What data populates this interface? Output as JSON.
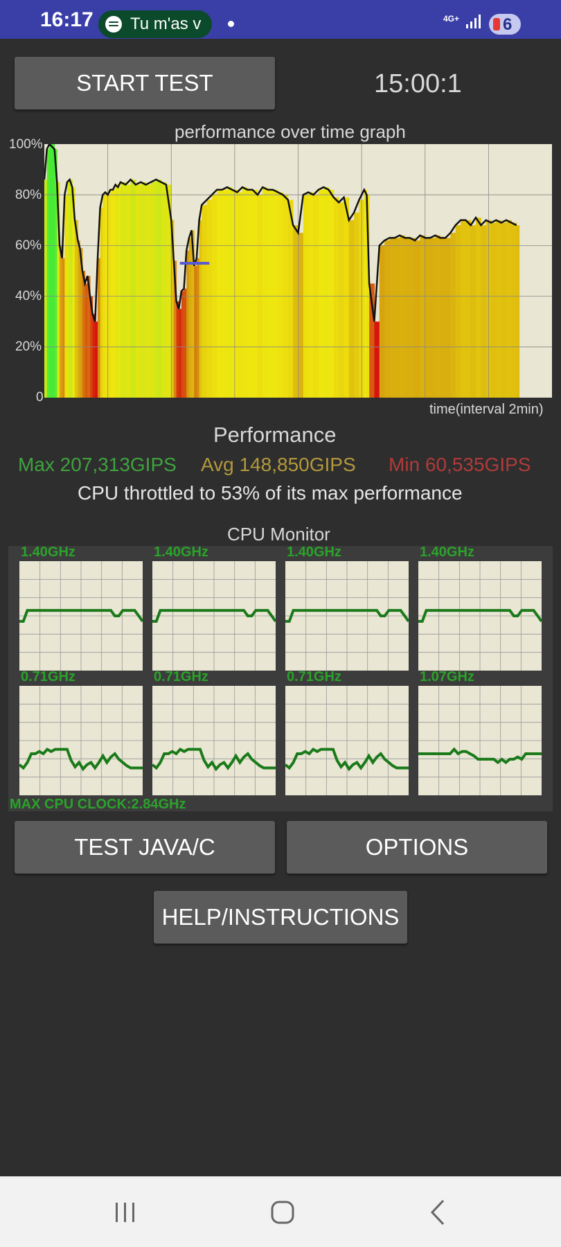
{
  "status_bar": {
    "time": "16:17",
    "media_pill_text": "Tu m'as v",
    "network": "4G+",
    "notification_count": "6"
  },
  "toolbar": {
    "start_test_label": "START TEST",
    "timer": "15:00:1"
  },
  "chart_data": {
    "type": "area",
    "title": "performance over time graph",
    "xlabel": "time(interval 2min)",
    "ylabel": "",
    "yticks": [
      "100%",
      "80%",
      "60%",
      "40%",
      "20%",
      "0"
    ],
    "ylim": [
      0,
      100
    ],
    "xlim": [
      0,
      1
    ],
    "grid": true,
    "x": [
      0.0,
      0.005,
      0.01,
      0.02,
      0.025,
      0.03,
      0.035,
      0.04,
      0.045,
      0.05,
      0.055,
      0.06,
      0.066,
      0.07,
      0.075,
      0.08,
      0.085,
      0.09,
      0.095,
      0.1,
      0.105,
      0.11,
      0.115,
      0.12,
      0.125,
      0.13,
      0.135,
      0.14,
      0.145,
      0.15,
      0.16,
      0.17,
      0.18,
      0.19,
      0.2,
      0.21,
      0.22,
      0.23,
      0.24,
      0.25,
      0.255,
      0.26,
      0.265,
      0.27,
      0.275,
      0.28,
      0.285,
      0.29,
      0.295,
      0.3,
      0.305,
      0.31,
      0.32,
      0.33,
      0.34,
      0.35,
      0.36,
      0.37,
      0.38,
      0.39,
      0.4,
      0.41,
      0.42,
      0.43,
      0.44,
      0.45,
      0.46,
      0.47,
      0.48,
      0.49,
      0.5,
      0.51,
      0.52,
      0.53,
      0.54,
      0.55,
      0.56,
      0.57,
      0.58,
      0.59,
      0.6,
      0.61,
      0.62,
      0.63,
      0.635,
      0.64,
      0.65,
      0.66,
      0.67,
      0.68,
      0.69,
      0.7,
      0.71,
      0.72,
      0.73,
      0.74,
      0.75,
      0.76,
      0.77,
      0.78,
      0.79,
      0.8,
      0.81,
      0.82,
      0.83,
      0.84,
      0.85,
      0.86,
      0.87,
      0.88,
      0.89,
      0.9,
      0.91,
      0.92,
      0.93
    ],
    "values": [
      86,
      98,
      100,
      98,
      85,
      60,
      55,
      80,
      85,
      86,
      83,
      70,
      62,
      59,
      50,
      45,
      48,
      40,
      33,
      30,
      55,
      75,
      80,
      81,
      80,
      82,
      82,
      84,
      83,
      85,
      84,
      86,
      84,
      85,
      84,
      85,
      86,
      85,
      84,
      70,
      54,
      38,
      35,
      42,
      43,
      58,
      63,
      66,
      52,
      55,
      70,
      76,
      78,
      80,
      82,
      82,
      83,
      82,
      81,
      83,
      82,
      82,
      80,
      83,
      82,
      82,
      81,
      80,
      78,
      68,
      65,
      80,
      81,
      80,
      82,
      83,
      82,
      79,
      77,
      79,
      70,
      73,
      78,
      82,
      80,
      45,
      30,
      60,
      62,
      63,
      63,
      64,
      63,
      63,
      62,
      64,
      63,
      63,
      64,
      63,
      63,
      65,
      68,
      70,
      70,
      68,
      71,
      68,
      70,
      69,
      70,
      69,
      70,
      69,
      68
    ],
    "series": [
      {
        "name": "Max",
        "value_label": "Max 207,313GIPS"
      },
      {
        "name": "Avg",
        "value_label": "Avg 148,850GIPS"
      },
      {
        "name": "Min",
        "value_label": "Min 60,535GIPS"
      }
    ],
    "throttle_percent": 53
  },
  "performance": {
    "title": "Performance",
    "max": "Max 207,313GIPS",
    "avg": "Avg 148,850GIPS",
    "min": "Min 60,535GIPS",
    "throttle_text": "CPU throttled to 53% of its max performance",
    "colors": {
      "max": "#3fa33f",
      "avg": "#b3993c",
      "min": "#b23a3a"
    }
  },
  "cpu_monitor": {
    "title": "CPU Monitor",
    "cores": [
      {
        "label": "1.40GHz",
        "trace": [
          0.45,
          0.45,
          0.55,
          0.55,
          0.55,
          0.55,
          0.55,
          0.55,
          0.55,
          0.55,
          0.55,
          0.55,
          0.55,
          0.55,
          0.55,
          0.55,
          0.55,
          0.55,
          0.55,
          0.55,
          0.55,
          0.55,
          0.55,
          0.55,
          0.5,
          0.5,
          0.55,
          0.55,
          0.55,
          0.55,
          0.5,
          0.45
        ]
      },
      {
        "label": "1.40GHz",
        "trace": [
          0.45,
          0.45,
          0.55,
          0.55,
          0.55,
          0.55,
          0.55,
          0.55,
          0.55,
          0.55,
          0.55,
          0.55,
          0.55,
          0.55,
          0.55,
          0.55,
          0.55,
          0.55,
          0.55,
          0.55,
          0.55,
          0.55,
          0.55,
          0.55,
          0.5,
          0.5,
          0.55,
          0.55,
          0.55,
          0.55,
          0.5,
          0.45
        ]
      },
      {
        "label": "1.40GHz",
        "trace": [
          0.45,
          0.45,
          0.55,
          0.55,
          0.55,
          0.55,
          0.55,
          0.55,
          0.55,
          0.55,
          0.55,
          0.55,
          0.55,
          0.55,
          0.55,
          0.55,
          0.55,
          0.55,
          0.55,
          0.55,
          0.55,
          0.55,
          0.55,
          0.55,
          0.5,
          0.5,
          0.55,
          0.55,
          0.55,
          0.55,
          0.5,
          0.45
        ]
      },
      {
        "label": "1.40GHz",
        "trace": [
          0.45,
          0.45,
          0.55,
          0.55,
          0.55,
          0.55,
          0.55,
          0.55,
          0.55,
          0.55,
          0.55,
          0.55,
          0.55,
          0.55,
          0.55,
          0.55,
          0.55,
          0.55,
          0.55,
          0.55,
          0.55,
          0.55,
          0.55,
          0.55,
          0.5,
          0.5,
          0.55,
          0.55,
          0.55,
          0.55,
          0.5,
          0.45
        ]
      },
      {
        "label": "0.71GHz",
        "trace": [
          0.28,
          0.25,
          0.3,
          0.38,
          0.38,
          0.4,
          0.38,
          0.42,
          0.4,
          0.42,
          0.42,
          0.42,
          0.42,
          0.32,
          0.26,
          0.3,
          0.24,
          0.28,
          0.3,
          0.25,
          0.3,
          0.36,
          0.3,
          0.35,
          0.38,
          0.33,
          0.3,
          0.27,
          0.25,
          0.25,
          0.25,
          0.25
        ]
      },
      {
        "label": "0.71GHz",
        "trace": [
          0.28,
          0.25,
          0.3,
          0.38,
          0.38,
          0.4,
          0.38,
          0.42,
          0.4,
          0.42,
          0.42,
          0.42,
          0.42,
          0.32,
          0.26,
          0.3,
          0.24,
          0.28,
          0.3,
          0.25,
          0.3,
          0.36,
          0.3,
          0.35,
          0.38,
          0.33,
          0.3,
          0.27,
          0.25,
          0.25,
          0.25,
          0.25
        ]
      },
      {
        "label": "0.71GHz",
        "trace": [
          0.28,
          0.25,
          0.3,
          0.38,
          0.38,
          0.4,
          0.38,
          0.42,
          0.4,
          0.42,
          0.42,
          0.42,
          0.42,
          0.32,
          0.26,
          0.3,
          0.24,
          0.28,
          0.3,
          0.25,
          0.3,
          0.36,
          0.3,
          0.35,
          0.38,
          0.33,
          0.3,
          0.27,
          0.25,
          0.25,
          0.25,
          0.25
        ]
      },
      {
        "label": "1.07GHz",
        "trace": [
          0.38,
          0.38,
          0.38,
          0.38,
          0.38,
          0.38,
          0.38,
          0.38,
          0.38,
          0.42,
          0.38,
          0.4,
          0.4,
          0.38,
          0.36,
          0.33,
          0.33,
          0.33,
          0.33,
          0.33,
          0.3,
          0.33,
          0.3,
          0.33,
          0.33,
          0.35,
          0.33,
          0.38,
          0.38,
          0.38,
          0.38,
          0.38
        ]
      }
    ],
    "max_clock": "MAX CPU CLOCK:2.84GHz",
    "line_color": "#1a7a1a"
  },
  "buttons": {
    "test_java_c": "TEST JAVA/C",
    "options": "OPTIONS",
    "help": "HELP/INSTRUCTIONS"
  },
  "nav": {
    "recents_icon": "recents-icon",
    "home_icon": "home-icon",
    "back_icon": "back-icon"
  }
}
